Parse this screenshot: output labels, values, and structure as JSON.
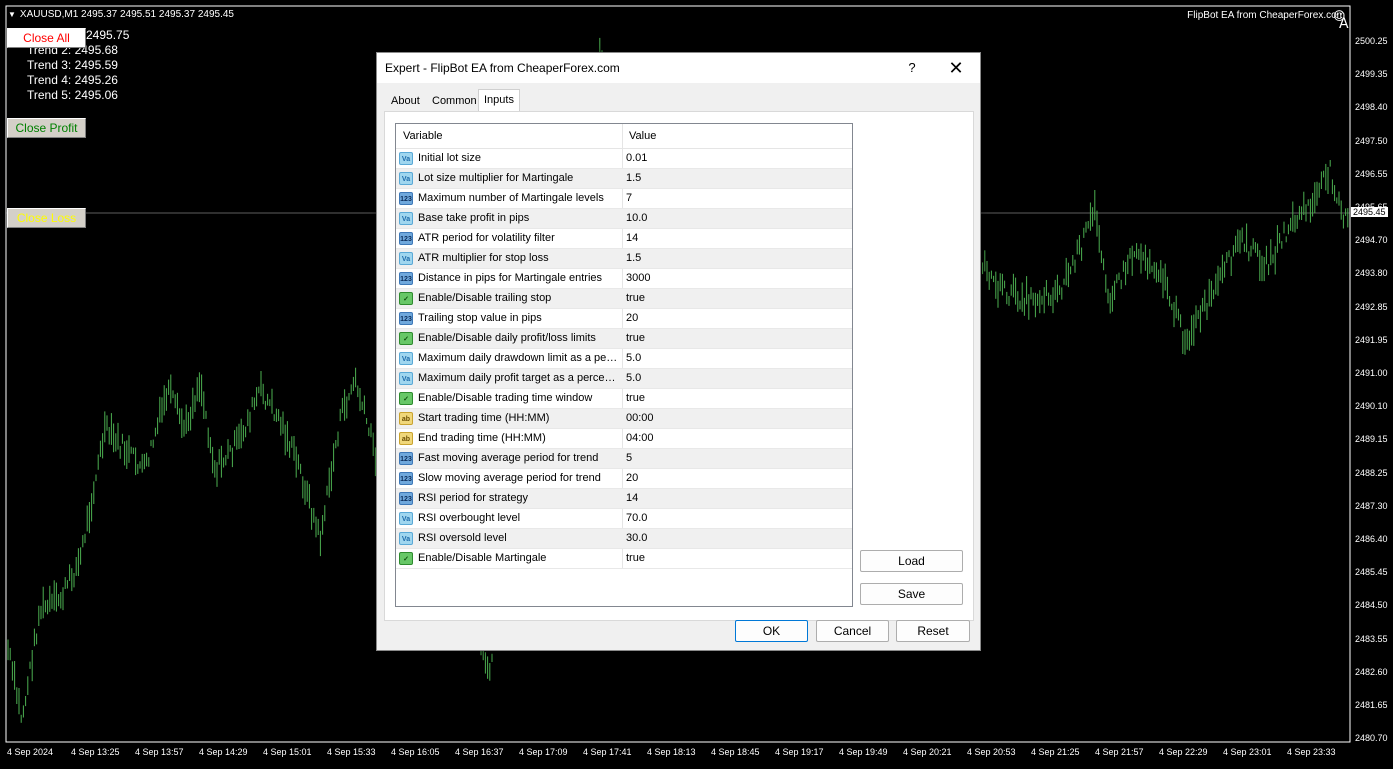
{
  "chart": {
    "symbol_header": "XAUUSD,M1  2495.37 2495.51 2495.37 2495.45",
    "ea_name": "FlipBot EA from CheaperForex.com",
    "corner_letter": "A",
    "current_price": "2495.45",
    "trend_lines": [
      "2495.75",
      "Trend 2: 2495.68",
      "Trend 3: 2495.59",
      "Trend 4: 2495.26",
      "Trend 5: 2495.06"
    ],
    "buttons": {
      "close_all": "Close All",
      "close_profit": "Close Profit",
      "close_loss": "Close Loss"
    },
    "price_axis": [
      "2500.25",
      "2499.35",
      "2498.40",
      "2497.50",
      "2496.55",
      "2495.65",
      "2494.70",
      "2493.80",
      "2492.85",
      "2491.95",
      "2491.00",
      "2490.10",
      "2489.15",
      "2488.25",
      "2487.30",
      "2486.40",
      "2485.45",
      "2484.50",
      "2483.55",
      "2482.60",
      "2481.65",
      "2480.70"
    ],
    "time_axis": [
      "4 Sep 2024",
      "4 Sep 13:25",
      "4 Sep 13:57",
      "4 Sep 14:29",
      "4 Sep 15:01",
      "4 Sep 15:33",
      "4 Sep 16:05",
      "4 Sep 16:37",
      "4 Sep 17:09",
      "4 Sep 17:41",
      "4 Sep 18:13",
      "4 Sep 18:45",
      "4 Sep 19:17",
      "4 Sep 19:49",
      "4 Sep 20:21",
      "4 Sep 20:53",
      "4 Sep 21:25",
      "4 Sep 21:57",
      "4 Sep 22:29",
      "4 Sep 23:01",
      "4 Sep 23:33"
    ],
    "colors": {
      "background": "#000000",
      "bars": "#4caf50",
      "text": "#ffffff"
    }
  },
  "dialog": {
    "title": "Expert - FlipBot EA from CheaperForex.com",
    "help": "?",
    "close": "✕",
    "tabs": [
      "About",
      "Common",
      "Inputs"
    ],
    "active_tab": "Inputs",
    "columns": [
      "Variable",
      "Value"
    ],
    "inputs": [
      {
        "icon": "double",
        "icon_text": "Va",
        "name": "Initial lot size",
        "value": "0.01"
      },
      {
        "icon": "double",
        "icon_text": "Va",
        "name": "Lot size multiplier for Martingale",
        "value": "1.5"
      },
      {
        "icon": "int",
        "icon_text": "123",
        "name": "Maximum number of Martingale levels",
        "value": "7"
      },
      {
        "icon": "double",
        "icon_text": "Va",
        "name": "Base take profit in pips",
        "value": "10.0"
      },
      {
        "icon": "int",
        "icon_text": "123",
        "name": "ATR period for volatility filter",
        "value": "14"
      },
      {
        "icon": "double",
        "icon_text": "Va",
        "name": "ATR multiplier for stop loss",
        "value": "1.5"
      },
      {
        "icon": "int",
        "icon_text": "123",
        "name": "Distance in pips for Martingale entries",
        "value": "3000"
      },
      {
        "icon": "bool",
        "icon_text": "✓",
        "name": "Enable/Disable trailing stop",
        "value": "true"
      },
      {
        "icon": "int",
        "icon_text": "123",
        "name": "Trailing stop value in pips",
        "value": "20"
      },
      {
        "icon": "bool",
        "icon_text": "✓",
        "name": "Enable/Disable daily profit/loss limits",
        "value": "true"
      },
      {
        "icon": "double",
        "icon_text": "Va",
        "name": "Maximum daily drawdown limit as a perc...",
        "value": "5.0"
      },
      {
        "icon": "double",
        "icon_text": "Va",
        "name": "Maximum daily profit target as a percenta...",
        "value": "5.0"
      },
      {
        "icon": "bool",
        "icon_text": "✓",
        "name": "Enable/Disable trading time window",
        "value": "true"
      },
      {
        "icon": "string",
        "icon_text": "ab",
        "name": "Start trading time (HH:MM)",
        "value": "00:00"
      },
      {
        "icon": "string",
        "icon_text": "ab",
        "name": "End trading time (HH:MM)",
        "value": "04:00"
      },
      {
        "icon": "int",
        "icon_text": "123",
        "name": "Fast moving average period for trend",
        "value": "5"
      },
      {
        "icon": "int",
        "icon_text": "123",
        "name": "Slow moving average period for trend",
        "value": "20"
      },
      {
        "icon": "int",
        "icon_text": "123",
        "name": "RSI period for strategy",
        "value": "14"
      },
      {
        "icon": "double",
        "icon_text": "Va",
        "name": "RSI overbought level",
        "value": "70.0"
      },
      {
        "icon": "double",
        "icon_text": "Va",
        "name": "RSI oversold level",
        "value": "30.0"
      },
      {
        "icon": "bool",
        "icon_text": "✓",
        "name": "Enable/Disable Martingale",
        "value": "true"
      }
    ],
    "side_buttons": {
      "load": "Load",
      "save": "Save"
    },
    "footer_buttons": {
      "ok": "OK",
      "cancel": "Cancel",
      "reset": "Reset"
    }
  }
}
